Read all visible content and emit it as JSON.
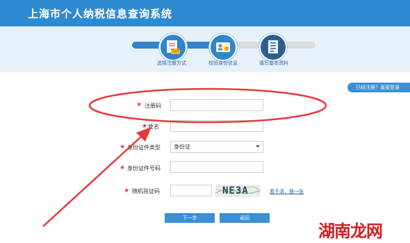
{
  "header": {
    "title": "上海市个人纳税信息查询系统"
  },
  "steps": [
    {
      "label": "选择注册方式",
      "icon": "document-mail-icon"
    },
    {
      "label": "校验身份信息",
      "icon": "id-card-icon"
    },
    {
      "label": "填写基本资料",
      "icon": "form-list-icon"
    }
  ],
  "login_link": "已经注册？直接登录",
  "form": {
    "reg_code_label": "注册码",
    "name_label": "姓名",
    "id_type_label": "身份证件类型",
    "id_type_value": "身份证",
    "id_number_label": "身份证件号码",
    "captcha_label": "随机验证码",
    "captcha_text": "NE3A",
    "refresh_text": "看不清，换一张",
    "required_mark": "★"
  },
  "buttons": {
    "next": "下一步",
    "back": "返回"
  },
  "watermark": "湖南龙网",
  "colors": {
    "header": "#2d8ad0",
    "accent": "#3a8fd6",
    "annotation": "#e4393c"
  }
}
